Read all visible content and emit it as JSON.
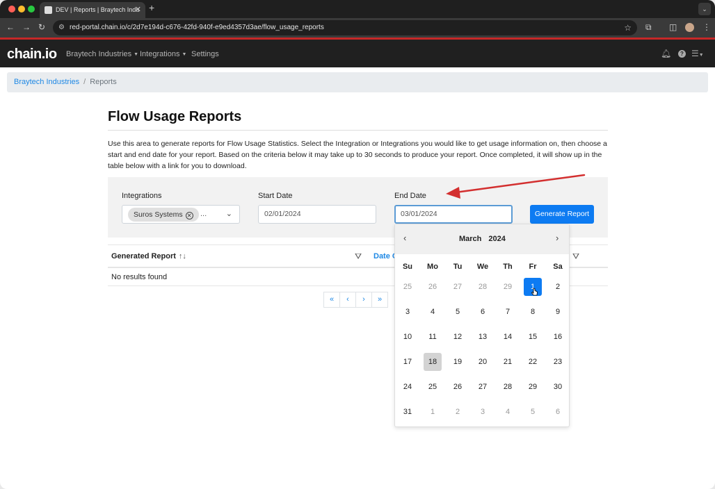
{
  "browser": {
    "tab_title": "DEV | Reports | Braytech Indu",
    "tab_close": "✕",
    "new_tab": "+",
    "url": "red-portal.chain.io/c/2d7e194d-c676-42fd-940f-e9ed4357d3ae/flow_usage_reports"
  },
  "navbar": {
    "logo": "chain.io",
    "links": [
      "Braytech Industries",
      "Integrations",
      "Settings"
    ]
  },
  "breadcrumb": {
    "link": "Braytech Industries",
    "separator": "/",
    "current": "Reports"
  },
  "page": {
    "title": "Flow Usage Reports",
    "description": "Use this area to generate reports for Flow Usage Statistics. Select the Integration or Integrations you would like to get usage information on, then choose a start and end date for your report. Based on the criteria below it may take up to 30 seconds to produce your report. Once completed, it will show up in the table below with a link for you to download."
  },
  "filters": {
    "integrations_label": "Integrations",
    "integration_chip": "Suros Systems",
    "integration_more": "...",
    "start_label": "Start Date",
    "start_value": "02/01/2024",
    "end_label": "End Date",
    "end_value": "03/01/2024",
    "generate_button": "Generate Report"
  },
  "table": {
    "col1": "Generated Report",
    "col2": "Date C",
    "empty_text": "No results found"
  },
  "pager": {
    "first": "«",
    "prev": "‹",
    "next": "›",
    "last": "»"
  },
  "datepicker": {
    "month": "March",
    "year": "2024",
    "weekdays": [
      "Su",
      "Mo",
      "Tu",
      "We",
      "Th",
      "Fr",
      "Sa"
    ],
    "weeks": [
      [
        "25",
        "26",
        "27",
        "28",
        "29",
        "1",
        "2"
      ],
      [
        "3",
        "4",
        "5",
        "6",
        "7",
        "8",
        "9"
      ],
      [
        "10",
        "11",
        "12",
        "13",
        "14",
        "15",
        "16"
      ],
      [
        "17",
        "18",
        "19",
        "20",
        "21",
        "22",
        "23"
      ],
      [
        "24",
        "25",
        "26",
        "27",
        "28",
        "29",
        "30"
      ],
      [
        "31",
        "1",
        "2",
        "3",
        "4",
        "5",
        "6"
      ]
    ],
    "selected_day": "1",
    "today_day": "18"
  },
  "colors": {
    "accent": "#0d7bf2",
    "link": "#1e88e5",
    "annotation_arrow": "#d32f2f"
  }
}
